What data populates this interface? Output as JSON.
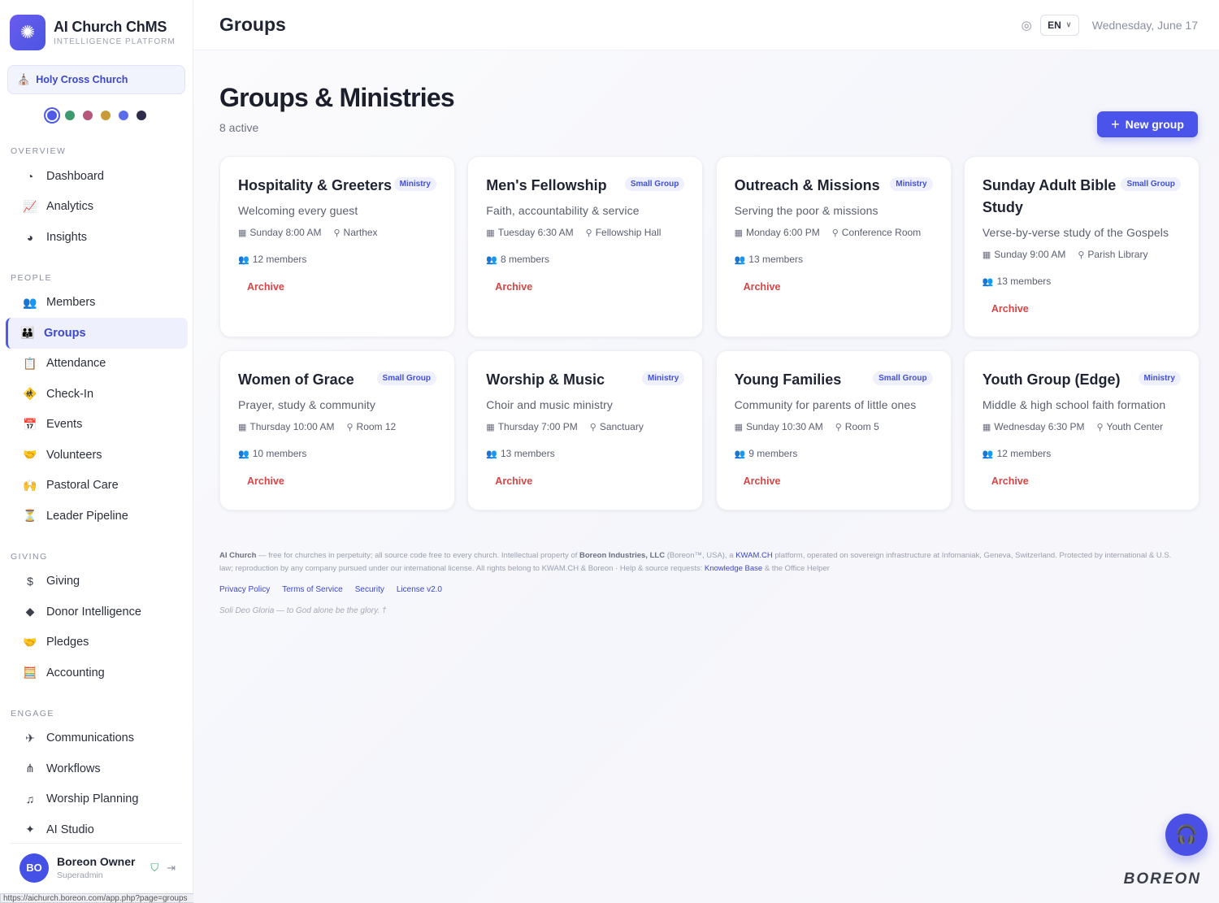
{
  "app": {
    "title": "AI Church ChMS",
    "subtitle": "INTELLIGENCE PLATFORM"
  },
  "church": {
    "name": "Holy Cross Church"
  },
  "theme_swatches": [
    "#4f5ae8",
    "#3d9a6f",
    "#b5577a",
    "#c99a3a",
    "#5b6de8",
    "#2b2d4a"
  ],
  "sidebar": {
    "sections": [
      {
        "title": "OVERVIEW",
        "items": [
          {
            "label": "Dashboard",
            "icon": "gauge-icon"
          },
          {
            "label": "Analytics",
            "icon": "line-chart-icon"
          },
          {
            "label": "Insights",
            "icon": "pie-chart-icon"
          }
        ]
      },
      {
        "title": "PEOPLE",
        "items": [
          {
            "label": "Members",
            "icon": "users-icon"
          },
          {
            "label": "Groups",
            "icon": "people-group-icon",
            "active": true
          },
          {
            "label": "Attendance",
            "icon": "clipboard-icon"
          },
          {
            "label": "Check-In",
            "icon": "child-icon"
          },
          {
            "label": "Events",
            "icon": "calendar-icon"
          },
          {
            "label": "Volunteers",
            "icon": "hands-helping-icon"
          },
          {
            "label": "Pastoral Care",
            "icon": "hands-heart-icon"
          },
          {
            "label": "Leader Pipeline",
            "icon": "hourglass-icon"
          }
        ]
      },
      {
        "title": "GIVING",
        "items": [
          {
            "label": "Giving",
            "icon": "dollar-icon"
          },
          {
            "label": "Donor Intelligence",
            "icon": "gem-icon"
          },
          {
            "label": "Pledges",
            "icon": "handshake-icon"
          },
          {
            "label": "Accounting",
            "icon": "calculator-icon"
          }
        ]
      },
      {
        "title": "ENGAGE",
        "items": [
          {
            "label": "Communications",
            "icon": "paper-plane-icon"
          },
          {
            "label": "Workflows",
            "icon": "workflow-icon"
          },
          {
            "label": "Worship Planning",
            "icon": "music-icon"
          },
          {
            "label": "AI Studio",
            "icon": "magic-wand-icon"
          }
        ]
      }
    ]
  },
  "user": {
    "initials": "BO",
    "name": "Boreon Owner",
    "role": "Superadmin"
  },
  "status_url": "https://aichurch.boreon.com/app.php?page=groups",
  "header": {
    "title": "Groups",
    "lang": "EN",
    "date": "Wednesday, June 17"
  },
  "main": {
    "heading": "Groups & Ministries",
    "count": "8 active",
    "new_button": "New group",
    "archive_label": "Archive"
  },
  "groups": [
    {
      "name": "Hospitality & Greeters",
      "type": "Ministry",
      "desc": "Welcoming every guest",
      "when": "Sunday 8:00 AM",
      "where": "Narthex",
      "members": "12 members"
    },
    {
      "name": "Men's Fellowship",
      "type": "Small Group",
      "desc": "Faith, accountability & service",
      "when": "Tuesday 6:30 AM",
      "where": "Fellowship Hall",
      "members": "8 members"
    },
    {
      "name": "Outreach & Missions",
      "type": "Ministry",
      "desc": "Serving the poor & missions",
      "when": "Monday 6:00 PM",
      "where": "Conference Room",
      "members": "13 members"
    },
    {
      "name": "Sunday Adult Bible Study",
      "type": "Small Group",
      "desc": "Verse-by-verse study of the Gospels",
      "when": "Sunday 9:00 AM",
      "where": "Parish Library",
      "members": "13 members"
    },
    {
      "name": "Women of Grace",
      "type": "Small Group",
      "desc": "Prayer, study & community",
      "when": "Thursday 10:00 AM",
      "where": "Room 12",
      "members": "10 members"
    },
    {
      "name": "Worship & Music",
      "type": "Ministry",
      "desc": "Choir and music ministry",
      "when": "Thursday 7:00 PM",
      "where": "Sanctuary",
      "members": "13 members"
    },
    {
      "name": "Young Families",
      "type": "Small Group",
      "desc": "Community for parents of little ones",
      "when": "Sunday 10:30 AM",
      "where": "Room 5",
      "members": "9 members"
    },
    {
      "name": "Youth Group (Edge)",
      "type": "Ministry",
      "desc": "Middle & high school faith formation",
      "when": "Wednesday 6:30 PM",
      "where": "Youth Center",
      "members": "12 members"
    }
  ],
  "footer": {
    "brand": "AI Church",
    "text1": " — free for churches in perpetuity; all source code free to every church. Intellectual property of ",
    "company": "Boreon Industries, LLC",
    "text2": " (Boreon™, USA), a ",
    "kwam": "KWAM.CH",
    "text3": " platform, operated on sovereign infrastructure at Infomaniak, Geneva, Switzerland. Protected by international & U.S. law; reproduction by any company pursued under our international license. All rights belong to KWAM.CH & Boreon · Help & source requests: ",
    "kb": "Knowledge Base",
    "text4": " & the Office Helper",
    "links": [
      "Privacy Policy",
      "Terms of Service",
      "Security",
      "License v2.0"
    ],
    "motto": "Soli Deo Gloria — to God alone be the glory. †"
  },
  "wordmark": "BOREON"
}
